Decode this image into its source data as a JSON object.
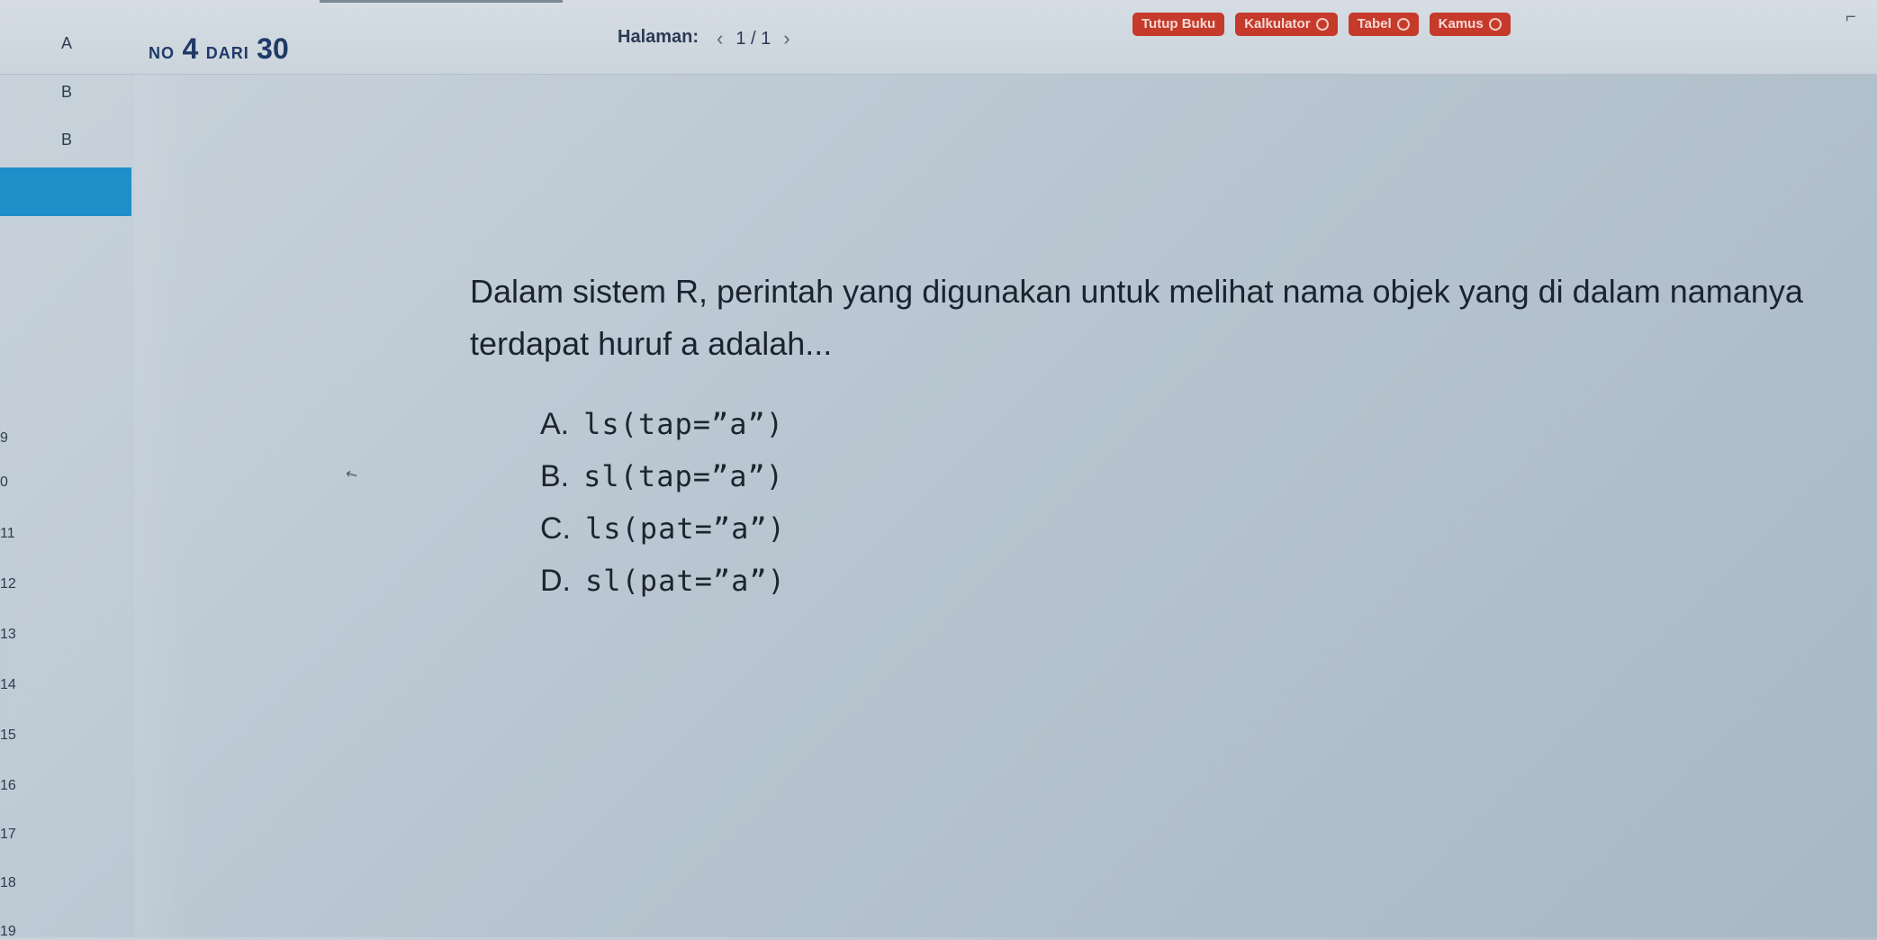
{
  "header": {
    "counter": {
      "prefix": "NO",
      "current": "4",
      "of": "DARI",
      "total": "30"
    },
    "page_label": "Halaman:",
    "page_value": "1 / 1",
    "tools": [
      "Tutup Buku",
      "Kalkulator",
      "Tabel",
      "Kamus"
    ]
  },
  "sidebar": {
    "letters": [
      "A",
      "B",
      "B"
    ],
    "numbers": [
      "9",
      "0",
      "11",
      "12",
      "13",
      "14",
      "15",
      "16",
      "17",
      "18",
      "19"
    ]
  },
  "question": {
    "text": "Dalam sistem R, perintah yang digunakan untuk melihat nama objek yang di dalam namanya terdapat huruf a adalah...",
    "options": [
      {
        "letter": "A.",
        "code": "ls(tap=”a”)"
      },
      {
        "letter": "B.",
        "code": "sl(tap=”a”)"
      },
      {
        "letter": "C.",
        "code": "ls(pat=”a”)"
      },
      {
        "letter": "D.",
        "code": "sl(pat=”a”)"
      }
    ]
  }
}
